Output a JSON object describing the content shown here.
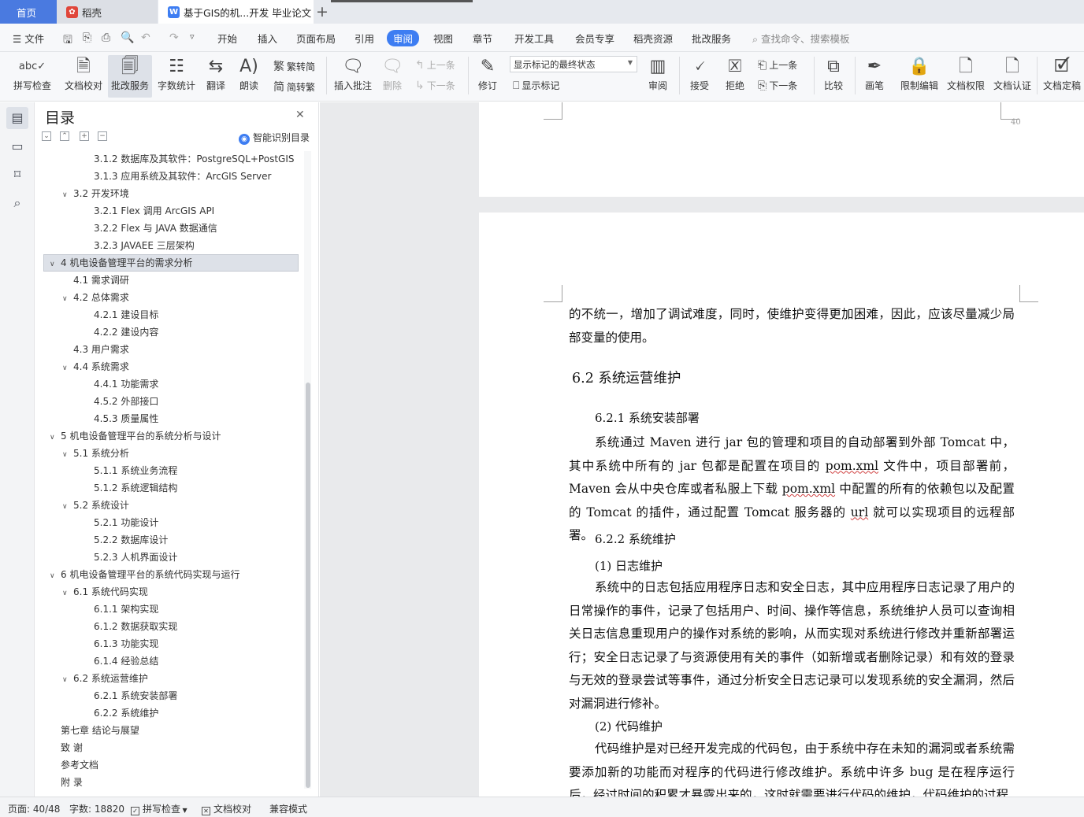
{
  "tabs": {
    "home": "首页",
    "daoke": "稻壳",
    "doc": "基于GIS的机...开发 毕业论文",
    "add": "+"
  },
  "menu": {
    "file": "文件",
    "items": [
      "开始",
      "插入",
      "页面布局",
      "引用",
      "审阅",
      "视图",
      "章节",
      "开发工具",
      "会员专享",
      "稻壳资源",
      "批改服务"
    ],
    "search": "查找命令、搜索模板"
  },
  "ribbon": {
    "spell_check": "拼写检查",
    "doc_proof": "文档校对",
    "review_service": "批改服务",
    "word_count": "字数统计",
    "translate": "翻译",
    "read_aloud": "朗读",
    "trad_to_simp": "繁转简",
    "simp_to_trad": "简转繁",
    "insert_comment": "插入批注",
    "delete": "删除",
    "prev": "上一条",
    "next": "下一条",
    "track_changes": "修订",
    "markup_state": "显示标记的最终状态",
    "show_markup": "显示标记",
    "review_pane": "审阅",
    "accept": "接受",
    "reject": "拒绝",
    "prev2": "上一条",
    "next2": "下一条",
    "compare": "比较",
    "pen": "画笔",
    "restrict_edit": "限制编辑",
    "doc_permission": "文档权限",
    "doc_certify": "文档认证",
    "doc_finalize": "文档定稿"
  },
  "toc": {
    "title": "目录",
    "smart": "智能识别目录",
    "items": [
      {
        "label": "3.1.2  数据库及其软件：PostgreSQL+PostGIS",
        "level": 3,
        "arrow": ""
      },
      {
        "label": "3.1.3  应用系统及其软件：ArcGIS Server",
        "level": 3,
        "arrow": ""
      },
      {
        "label": "3.2  开发环境",
        "level": 2,
        "arrow": "∨"
      },
      {
        "label": "3.2.1 Flex 调用 ArcGIS API",
        "level": 3,
        "arrow": ""
      },
      {
        "label": "3.2.2 Flex 与 JAVA 数据通信",
        "level": 3,
        "arrow": ""
      },
      {
        "label": "3.2.3 JAVAEE 三层架构",
        "level": 3,
        "arrow": ""
      },
      {
        "label": "4  机电设备管理平台的需求分析",
        "level": 1,
        "arrow": "∨"
      },
      {
        "label": "4.1  需求调研",
        "level": 2,
        "arrow": ""
      },
      {
        "label": "4.2  总体需求",
        "level": 2,
        "arrow": "∨"
      },
      {
        "label": "4.2.1  建设目标",
        "level": 3,
        "arrow": ""
      },
      {
        "label": "4.2.2  建设内容",
        "level": 3,
        "arrow": ""
      },
      {
        "label": "4.3  用户需求",
        "level": 2,
        "arrow": ""
      },
      {
        "label": "4.4  系统需求",
        "level": 2,
        "arrow": "∨"
      },
      {
        "label": "4.4.1  功能需求",
        "level": 3,
        "arrow": ""
      },
      {
        "label": "4.5.2  外部接口",
        "level": 3,
        "arrow": ""
      },
      {
        "label": "4.5.3  质量属性",
        "level": 3,
        "arrow": ""
      },
      {
        "label": "5  机电设备管理平台的系统分析与设计",
        "level": 1,
        "arrow": "∨"
      },
      {
        "label": "5.1  系统分析",
        "level": 2,
        "arrow": "∨"
      },
      {
        "label": "5.1.1  系统业务流程",
        "level": 3,
        "arrow": ""
      },
      {
        "label": "5.1.2  系统逻辑结构",
        "level": 3,
        "arrow": ""
      },
      {
        "label": "5.2  系统设计",
        "level": 2,
        "arrow": "∨"
      },
      {
        "label": "5.2.1  功能设计",
        "level": 3,
        "arrow": ""
      },
      {
        "label": "5.2.2  数据库设计",
        "level": 3,
        "arrow": ""
      },
      {
        "label": "5.2.3  人机界面设计",
        "level": 3,
        "arrow": ""
      },
      {
        "label": "6  机电设备管理平台的系统代码实现与运行",
        "level": 1,
        "arrow": "∨"
      },
      {
        "label": "6.1  系统代码实现",
        "level": 2,
        "arrow": "∨"
      },
      {
        "label": "6.1.1  架构实现",
        "level": 3,
        "arrow": ""
      },
      {
        "label": "6.1.2  数据获取实现",
        "level": 3,
        "arrow": ""
      },
      {
        "label": "6.1.3  功能实现",
        "level": 3,
        "arrow": ""
      },
      {
        "label": "6.1.4  经验总结",
        "level": 3,
        "arrow": ""
      },
      {
        "label": "6.2  系统运营维护",
        "level": 2,
        "arrow": "∨"
      },
      {
        "label": "6.2.1  系统安装部署",
        "level": 3,
        "arrow": ""
      },
      {
        "label": "6.2.2  系统维护",
        "level": 3,
        "arrow": ""
      },
      {
        "label": "第七章   结论与展望",
        "level": 1,
        "arrow": ""
      },
      {
        "label": "致   谢",
        "level": 1,
        "arrow": ""
      },
      {
        "label": "参考文档",
        "level": 1,
        "arrow": ""
      },
      {
        "label": "附   录",
        "level": 1,
        "arrow": ""
      }
    ]
  },
  "doc": {
    "page_number": "40",
    "p0": "的不统一，增加了调试难度，同时，使维护变得更加困难，因此，应该尽量减少局部变量的使用。",
    "h1": "6.2  系统运营维护",
    "h2a": "6.2.1  系统安装部署",
    "p1a": "系统通过 Maven 进行 jar 包的管理和项目的自动部署到外部 Tomcat 中，其中系统中所有的 jar 包都是配置在项目的 ",
    "p1_pom": "pom.xml",
    "p1b": " 文件中，项目部署前，Maven 会从中央仓库或者私服上下载 ",
    "p1_pom2": "pom.xml",
    "p1c": " 中配置的所有的依赖包以及配置的 Tomcat 的插件，通过配置 Tomcat 服务器的 ",
    "p1_url": "url",
    "p1d": " 就可以实现项目的远程部署。",
    "h2b": "6.2.2  系统维护",
    "h3a": "(1)  日志维护",
    "p2": "系统中的日志包括应用程序日志和安全日志，其中应用程序日志记录了用户的日常操作的事件，记录了包括用户、时间、操作等信息，系统维护人员可以查询相关日志信息重现用户的操作对系统的影响，从而实现对系统进行修改并重新部署运行；安全日志记录了与资源使用有关的事件（如新增或者删除记录）和有效的登录与无效的登录尝试等事件，通过分析安全日志记录可以发现系统的安全漏洞，然后对漏洞进行修补。",
    "h3b": "(2)  代码维护",
    "p3": "代码维护是对已经开发完成的代码包，由于系统中存在未知的漏洞或者系统需要添加新的功能而对程序的代码进行修改维护。系统中许多 bug 是在程序运行后，经过时间的积累才暴露出来的，这时就需要进行代码的维护，代码维护的过程"
  },
  "status": {
    "page": "页面: 40/48",
    "words": "字数: 18820",
    "spell": "拼写检查",
    "proof": "文档校对",
    "compat": "兼容模式"
  }
}
